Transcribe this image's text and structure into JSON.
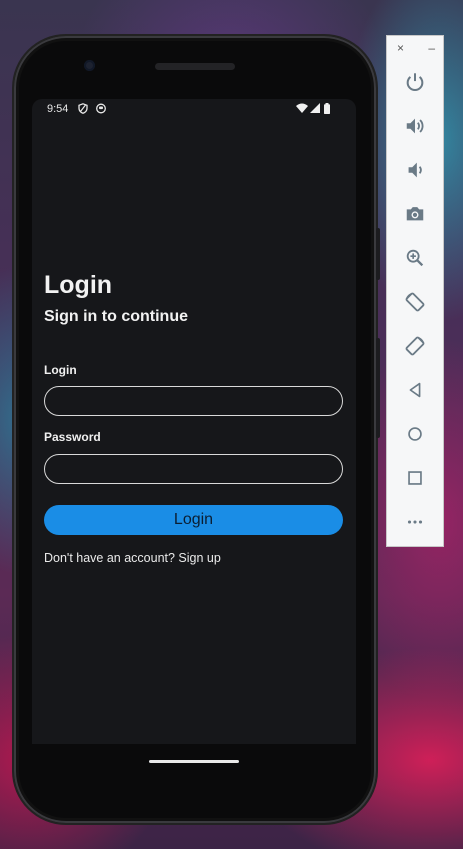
{
  "status_bar": {
    "time": "9:54"
  },
  "login_screen": {
    "title": "Login",
    "subtitle": "Sign in to continue",
    "login_label": "Login",
    "login_value": "",
    "password_label": "Password",
    "password_value": "",
    "login_button": "Login",
    "signup_text": "Don't have an account? Sign up"
  },
  "emulator_toolbar": {
    "close": "×",
    "minimize": "–",
    "buttons": [
      "power-icon",
      "volume-up-icon",
      "volume-down-icon",
      "camera-icon",
      "zoom-icon",
      "rotate-left-icon",
      "rotate-right-icon",
      "back-icon",
      "home-icon",
      "overview-icon",
      "more-icon"
    ]
  },
  "colors": {
    "accent": "#1a8de6",
    "screen_bg": "#16171a",
    "toolbar_icon": "#6a7a86"
  }
}
